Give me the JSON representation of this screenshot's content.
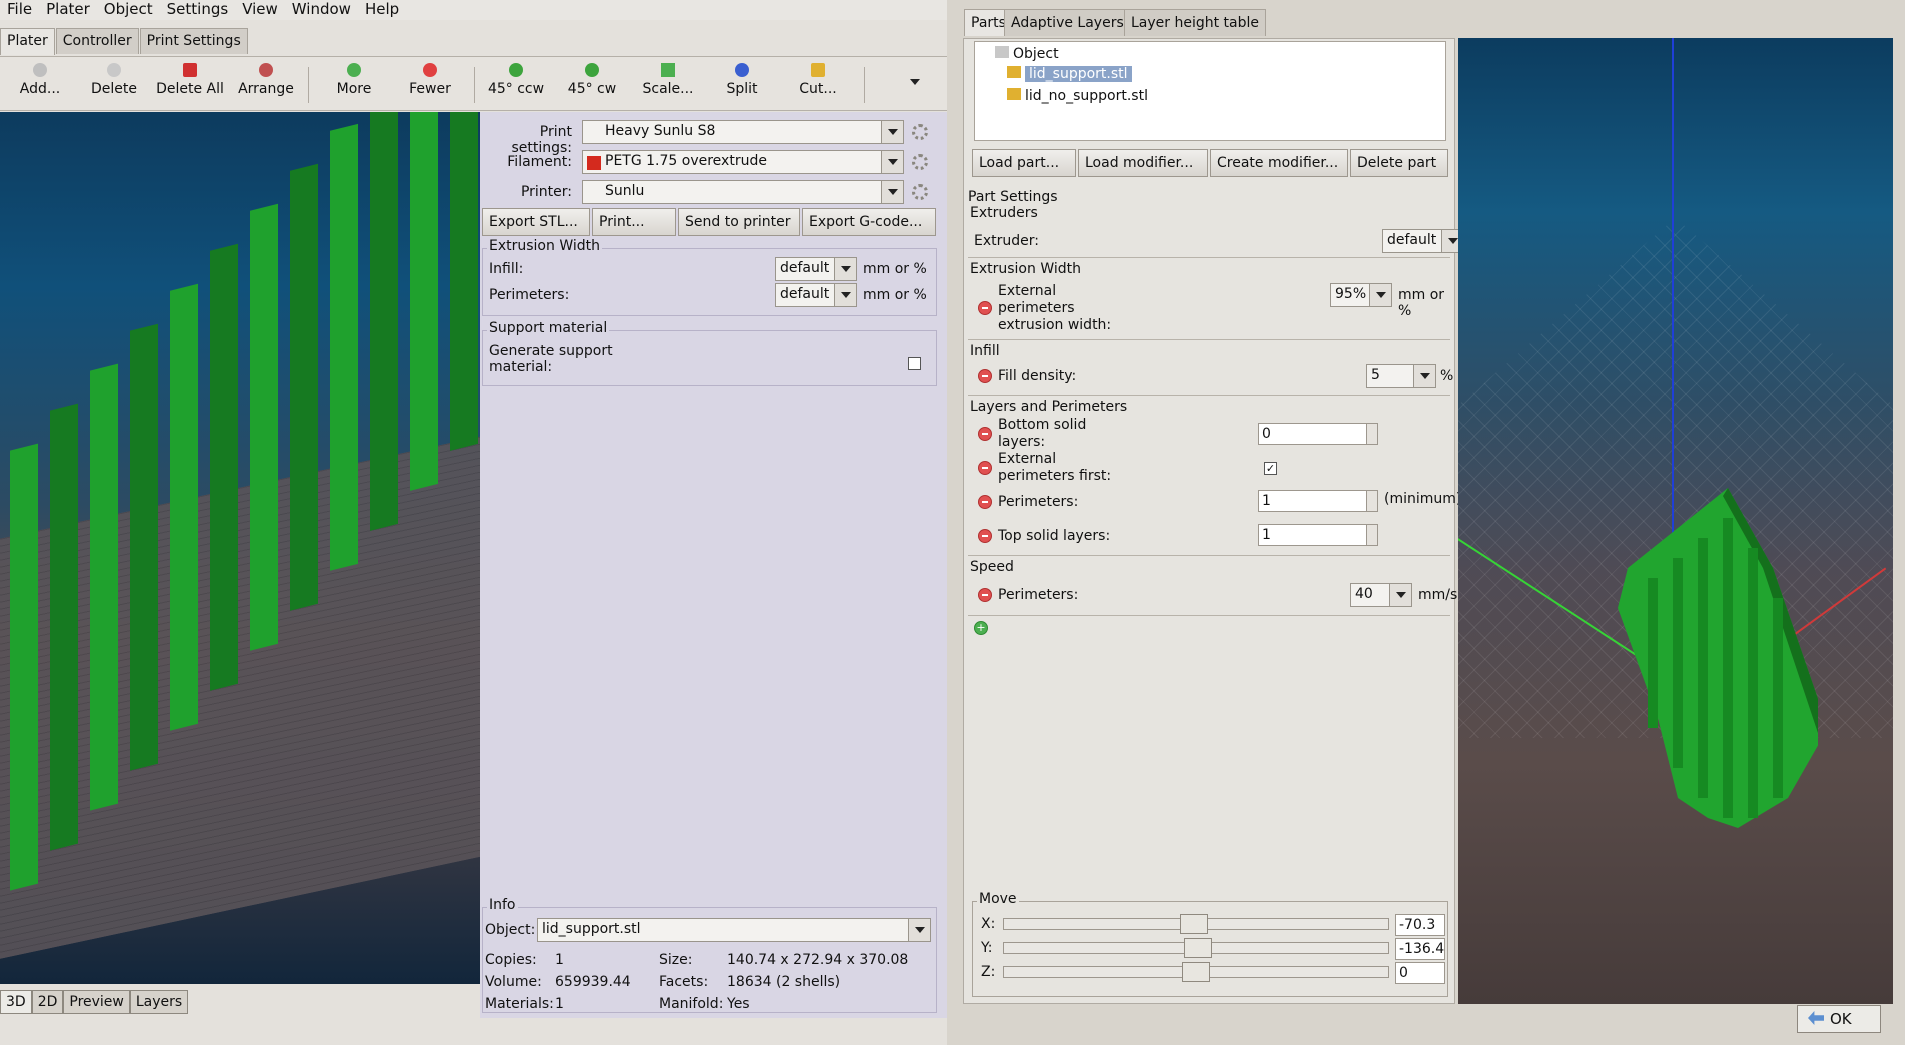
{
  "menu": [
    "File",
    "Plater",
    "Object",
    "Settings",
    "View",
    "Window",
    "Help"
  ],
  "main_tabs": [
    "Plater",
    "Controller",
    "Print Settings"
  ],
  "toolbar": {
    "add": "Add...",
    "delete": "Delete",
    "delete_all": "Delete All",
    "arrange": "Arrange",
    "more": "More",
    "fewer": "Fewer",
    "ccw": "45° ccw",
    "cw": "45° cw",
    "scale": "Scale...",
    "split": "Split",
    "cut": "Cut..."
  },
  "view_tabs": [
    "3D",
    "2D",
    "Preview",
    "Layers"
  ],
  "settings": {
    "print_label": "Print settings:",
    "print_value": "Heavy Sunlu S8",
    "filament_label": "Filament:",
    "filament_value": "PETG 1.75 overextrude",
    "filament_color": "#d42a1e",
    "printer_label": "Printer:",
    "printer_value": "Sunlu"
  },
  "actions": {
    "export_stl": "Export STL...",
    "print": "Print...",
    "send": "Send to printer",
    "export_gcode": "Export G-code..."
  },
  "extrusion": {
    "title": "Extrusion Width",
    "infill_label": "Infill:",
    "infill_value": "default",
    "perim_label": "Perimeters:",
    "perim_value": "default",
    "unit": "mm or %"
  },
  "support": {
    "title": "Support material",
    "label": "Generate support material:"
  },
  "info": {
    "title": "Info",
    "object_label": "Object:",
    "object_value": "lid_support.stl",
    "copies_label": "Copies:",
    "copies": "1",
    "size_label": "Size:",
    "size": "140.74 x 272.94 x 370.08",
    "volume_label": "Volume:",
    "volume": "659939.44",
    "facets_label": "Facets:",
    "facets": "18634 (2 shells)",
    "materials_label": "Materials:",
    "materials": "1",
    "manifold_label": "Manifold:",
    "manifold": "Yes"
  },
  "dialog": {
    "tabs": [
      "Parts",
      "Adaptive Layers",
      "Layer height table"
    ],
    "tree": {
      "root": "Object",
      "items": [
        "lid_support.stl",
        "lid_no_support.stl"
      ]
    },
    "buttons": {
      "load_part": "Load part...",
      "load_modifier": "Load modifier...",
      "create_modifier": "Create modifier...",
      "delete_part": "Delete part"
    },
    "part_settings": "Part Settings",
    "extruders": {
      "title": "Extruders",
      "label": "Extruder:",
      "value": "default"
    },
    "ext_width": {
      "title": "Extrusion Width",
      "label1": "External",
      "label2": "perimeters",
      "label3": "extrusion width:",
      "value": "95%",
      "unit": "mm or %"
    },
    "infill": {
      "title": "Infill",
      "label": "Fill density:",
      "value": "5",
      "unit": "%"
    },
    "layers": {
      "title": "Layers and Perimeters",
      "bottom_label1": "Bottom solid",
      "bottom_label2": "layers:",
      "bottom_value": "0",
      "ext_first1": "External",
      "ext_first2": "perimeters first:",
      "ext_first_checked": true,
      "perim_label": "Perimeters:",
      "perim_value": "1",
      "perim_unit": "(minimum)",
      "top_label": "Top solid layers:",
      "top_value": "1"
    },
    "speed": {
      "title": "Speed",
      "label": "Perimeters:",
      "value": "40",
      "unit": "mm/s"
    },
    "move": {
      "title": "Move",
      "x_label": "X:",
      "x_value": "-70.3",
      "y_label": "Y:",
      "y_value": "-136.4",
      "z_label": "Z:",
      "z_value": "0"
    },
    "ok": "OK"
  }
}
